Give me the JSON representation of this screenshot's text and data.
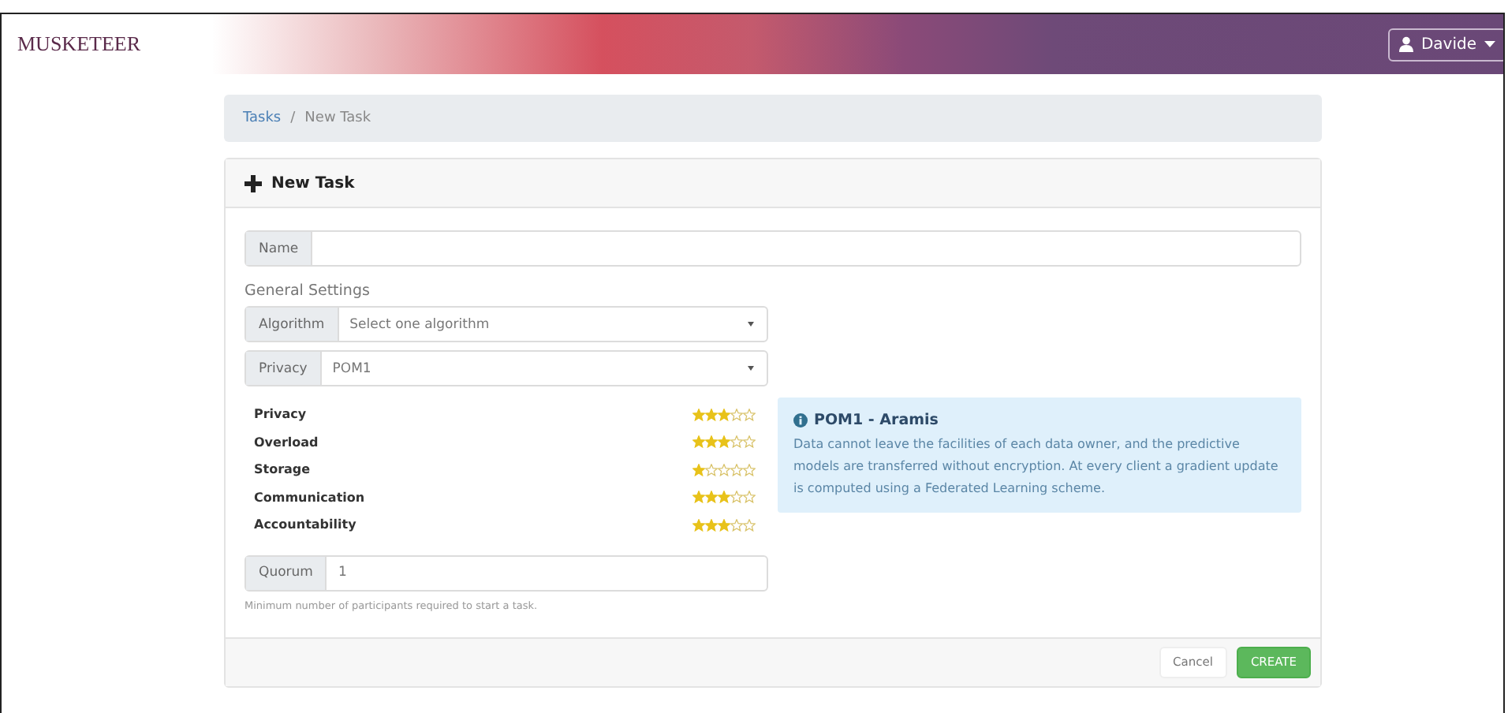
{
  "navbar": {
    "logo": "MUSKETEER",
    "user": "Davide"
  },
  "breadcrumb": [
    {
      "label": "Tasks",
      "kind": "link"
    },
    {
      "label": "/",
      "kind": "separator"
    },
    {
      "label": "New Task",
      "kind": "current"
    }
  ],
  "card": {
    "title": "New Task",
    "name_field": {
      "label": "Name"
    },
    "section_title": "General Settings",
    "algorithm": {
      "label": "Algorithm",
      "placeholder": "Select one algorithm"
    },
    "privacy": {
      "label": "Privacy",
      "value": "POM1"
    },
    "ratings": [
      {
        "name": "Privacy",
        "stars": 3
      },
      {
        "name": "Overload",
        "stars": 3
      },
      {
        "name": "Storage",
        "stars": 1
      },
      {
        "name": "Communication",
        "stars": 3
      },
      {
        "name": "Accountability",
        "stars": 3
      }
    ],
    "info": {
      "title": "POM1 - Aramis",
      "text": "Data cannot leave the facilities of each data owner, and the predictive models are transferred without encryption. At every client a gradient update is computed using a Federated Learning scheme."
    },
    "quorum": {
      "label": "Quorum",
      "value": "1",
      "help": "Minimum number of participants required to start a task."
    },
    "buttons": [
      {
        "label": "Cancel",
        "kind": "secondary"
      },
      {
        "label": "CREATE",
        "kind": "primary"
      }
    ]
  }
}
